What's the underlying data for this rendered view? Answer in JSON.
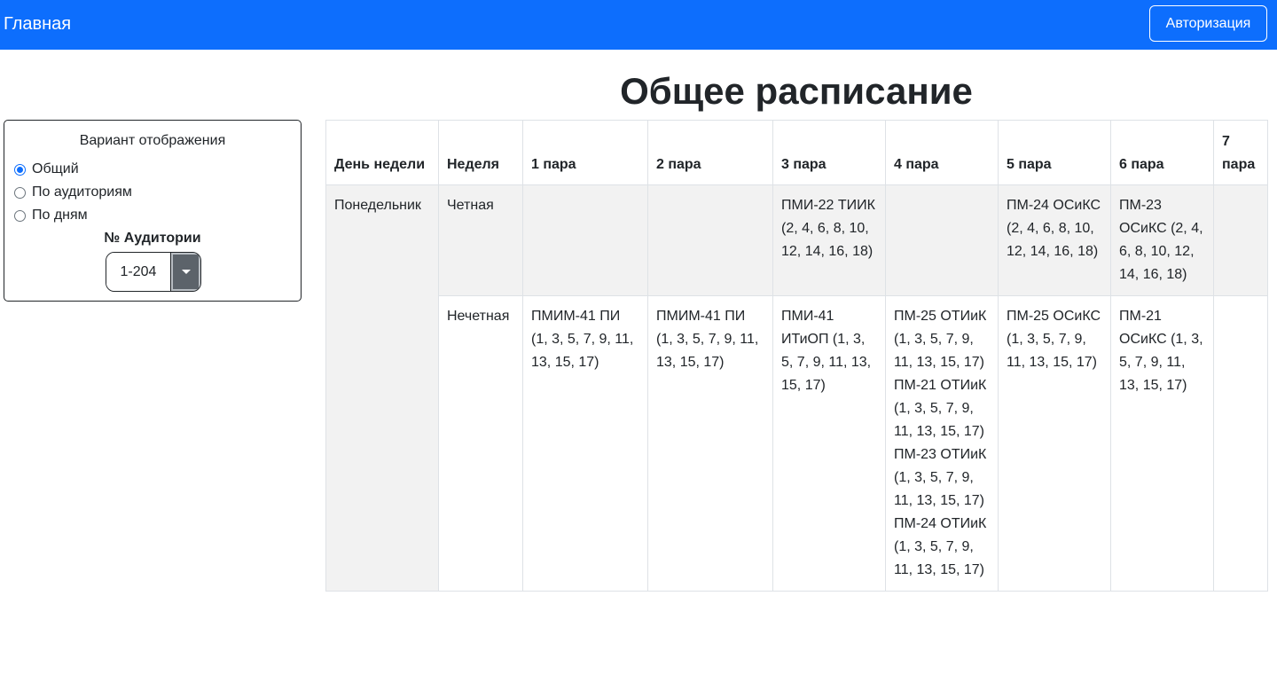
{
  "navbar": {
    "brand": "Главная",
    "auth_button": "Авторизация"
  },
  "page_title": "Общее расписание",
  "panel": {
    "title": "Вариант отображения",
    "options": [
      {
        "label": "Общий",
        "checked": true
      },
      {
        "label": "По аудиториям",
        "checked": false
      },
      {
        "label": "По дням",
        "checked": false
      }
    ],
    "auditorium_label": "№ Аудитории",
    "auditorium_value": "1-204"
  },
  "table": {
    "headers": [
      "День недели",
      "Неделя",
      "1 пара",
      "2 пара",
      "3 пара",
      "4 пара",
      "5 пара",
      "6 пара",
      "7 пара"
    ],
    "rows": [
      {
        "day": "Понедельник",
        "week": "Четная",
        "cells": [
          [],
          [],
          [
            "ПМИ-22 ТИИК (2, 4, 6, 8, 10, 12, 14, 16, 18)"
          ],
          [],
          [
            "ПМ-24 ОСиКС (2, 4, 6, 8, 10, 12, 14, 16, 18)"
          ],
          [
            "ПМ-23 ОСиКС (2, 4, 6, 8, 10, 12, 14, 16, 18)"
          ],
          []
        ]
      },
      {
        "day": "",
        "week": "Нечетная",
        "cells": [
          [
            "ПМИМ-41 ПИ (1, 3, 5, 7, 9, 11, 13, 15, 17)"
          ],
          [
            "ПМИМ-41 ПИ (1, 3, 5, 7, 9, 11, 13, 15, 17)"
          ],
          [
            "ПМИ-41 ИТиОП (1, 3, 5, 7, 9, 11, 13, 15, 17)"
          ],
          [
            "ПМ-25 ОТИиК (1, 3, 5, 7, 9, 11, 13, 15, 17)",
            "ПМ-21 ОТИиК (1, 3, 5, 7, 9, 11, 13, 15, 17)",
            "ПМ-23 ОТИиК (1, 3, 5, 7, 9, 11, 13, 15, 17)",
            "ПМ-24 ОТИиК (1, 3, 5, 7, 9, 11, 13, 15, 17)"
          ],
          [
            "ПМ-25 ОСиКС (1, 3, 5, 7, 9, 11, 13, 15, 17)"
          ],
          [
            "ПМ-21 ОСиКС (1, 3, 5, 7, 9, 11, 13, 15, 17)"
          ],
          []
        ]
      }
    ]
  }
}
